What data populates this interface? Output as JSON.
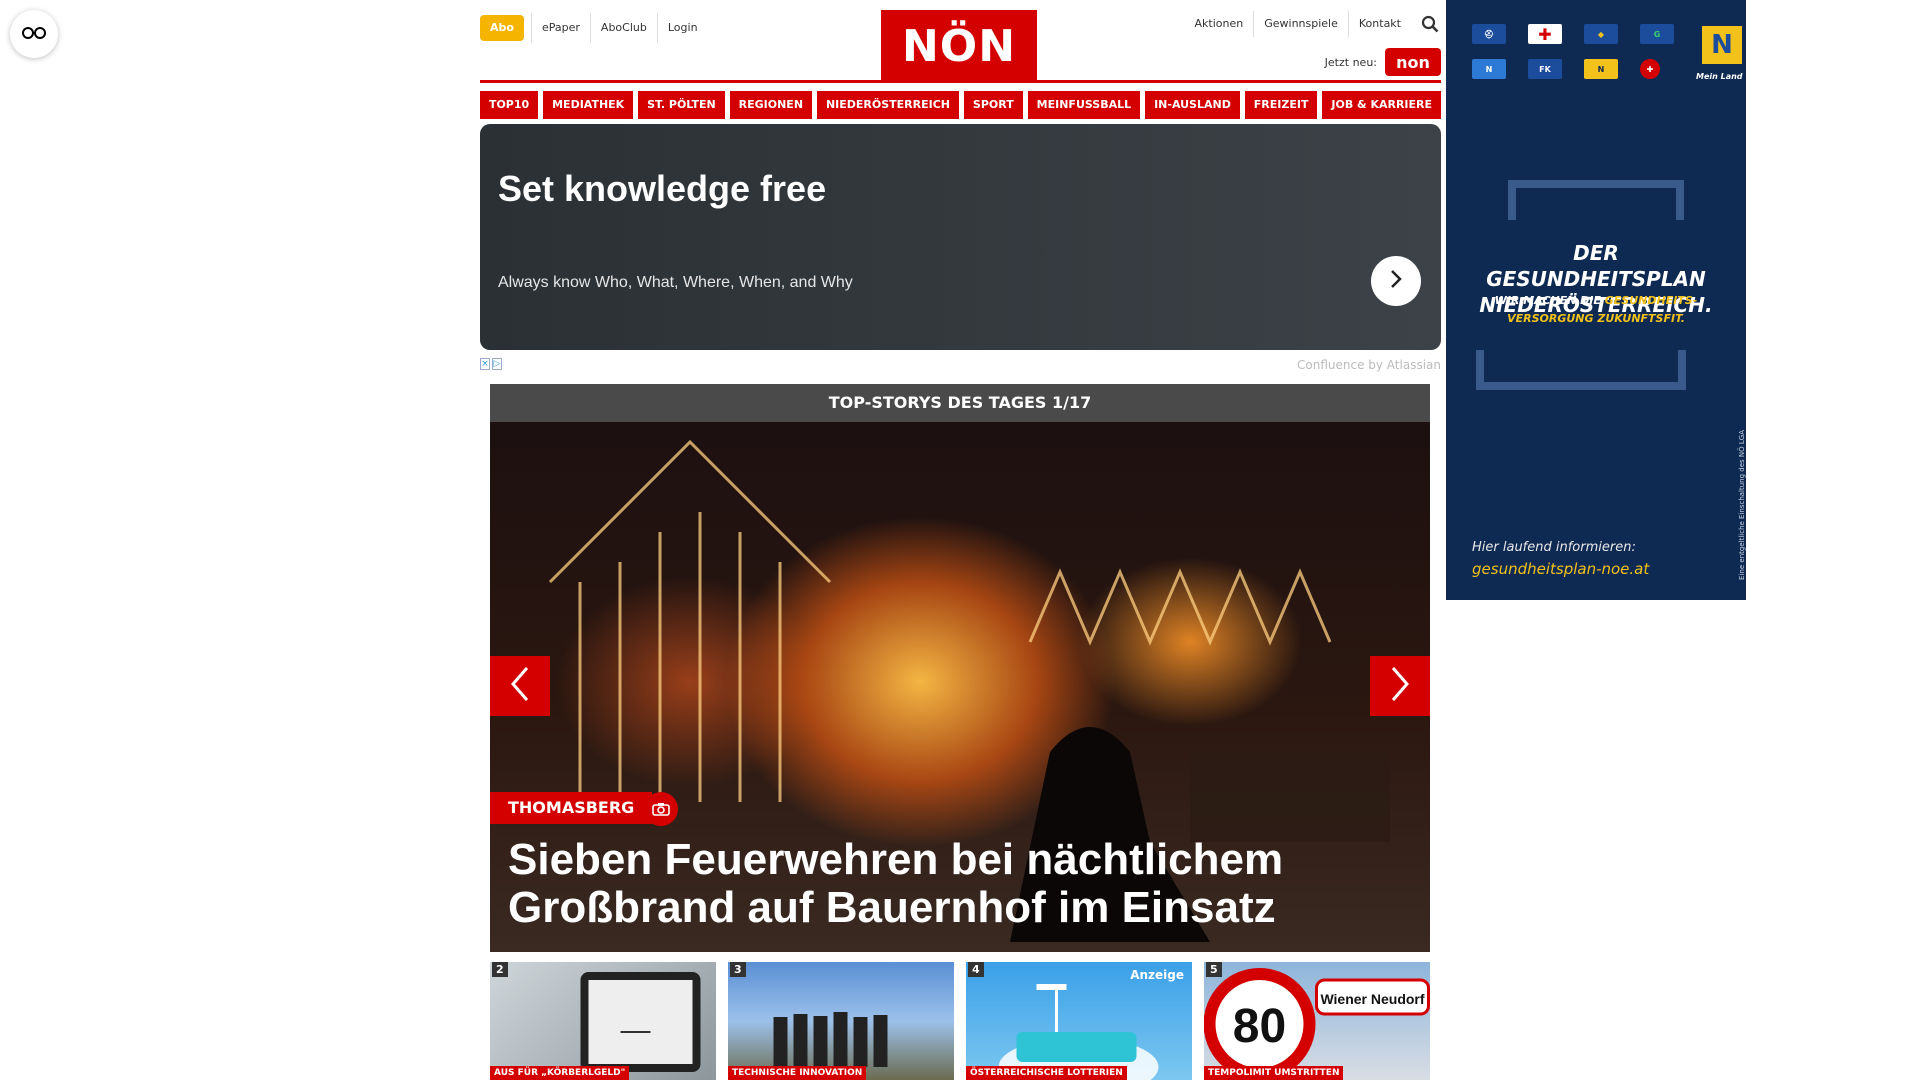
{
  "accessibility": {
    "icon": "glasses-icon"
  },
  "header": {
    "abo_label": "Abo",
    "left_links": [
      "ePaper",
      "AboClub",
      "Login"
    ],
    "logo_text": "NÖN",
    "right_links": [
      "Aktionen",
      "Gewinnspiele",
      "Kontakt"
    ],
    "search_icon": "search-icon",
    "jetzt_label": "Jetzt neu:",
    "jetzt_badge": "non"
  },
  "nav": [
    "TOP10",
    "MEDIATHEK",
    "ST. PÖLTEN",
    "REGIONEN",
    "NIEDERÖSTERREICH",
    "SPORT",
    "MEINFUSSBALL",
    "IN-AUSLAND",
    "FREIZEIT",
    "JOB & KARRIERE"
  ],
  "ad": {
    "title": "Set knowledge free",
    "subtitle": "Always know Who, What, Where, When, and Why",
    "source": "Confluence by Atlassian"
  },
  "topstory": {
    "header": "TOP-STORYS DES TAGES 1/17",
    "tag": "THOMASBERG",
    "headline": "Sieben Feuerwehren bei nächtlichem Großbrand auf Bauernhof im Einsatz"
  },
  "thumbs": [
    {
      "num": "2",
      "label": "AUS FÜR „KÖRBERLGELD\"",
      "anzeige": ""
    },
    {
      "num": "3",
      "label": "TECHNISCHE INNOVATION",
      "anzeige": ""
    },
    {
      "num": "4",
      "label": "ÖSTERREICHISCHE LOTTERIEN",
      "anzeige": "Anzeige"
    },
    {
      "num": "5",
      "label": "TEMPOLIMIT UMSTRITTEN",
      "anzeige": ""
    }
  ],
  "sidebar_ad": {
    "headline": "DER GESUNDHEITSPLAN NIEDERÖSTERREICH.",
    "sub_plain": "WIR MACHEN DIE ",
    "sub_highlight": "GESUNDHEITS-VERSORGUNG ZUKUNFTSFIT.",
    "small": "Hier laufend informieren:",
    "url": "gesundheitsplan-noe.at",
    "vertical_text": "Eine entgeltliche Einschaltung des NÖ LGA",
    "logo_caption": "Mein Land"
  }
}
